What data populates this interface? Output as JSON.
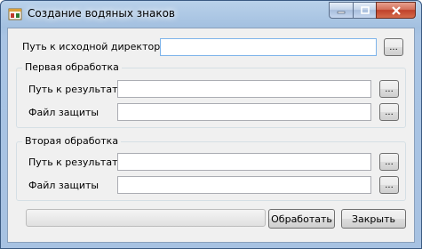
{
  "window": {
    "title": "Создание водяных знаков",
    "icon": "app-icon",
    "controls": [
      "minimize-icon",
      "maximize-icon",
      "close-icon"
    ]
  },
  "source": {
    "label": "Путь к исходной директории",
    "value": "",
    "browse_label": "..."
  },
  "groups": [
    {
      "title": "Первая обработка",
      "result_label": "Путь к результату",
      "result_value": "",
      "protection_label": "Файл защиты",
      "protection_value": "",
      "browse_label": "..."
    },
    {
      "title": "Вторая обработка",
      "result_label": "Путь к результату",
      "result_value": "",
      "protection_label": "Файл защиты",
      "protection_value": "",
      "browse_label": "..."
    }
  ],
  "progress": {
    "value": 0
  },
  "buttons": {
    "process": "Обработать",
    "close": "Закрыть"
  },
  "colors": {
    "titlebar": "#a9c4e4",
    "client": "#f0f0f0",
    "focus_border": "#7eb4ea"
  }
}
